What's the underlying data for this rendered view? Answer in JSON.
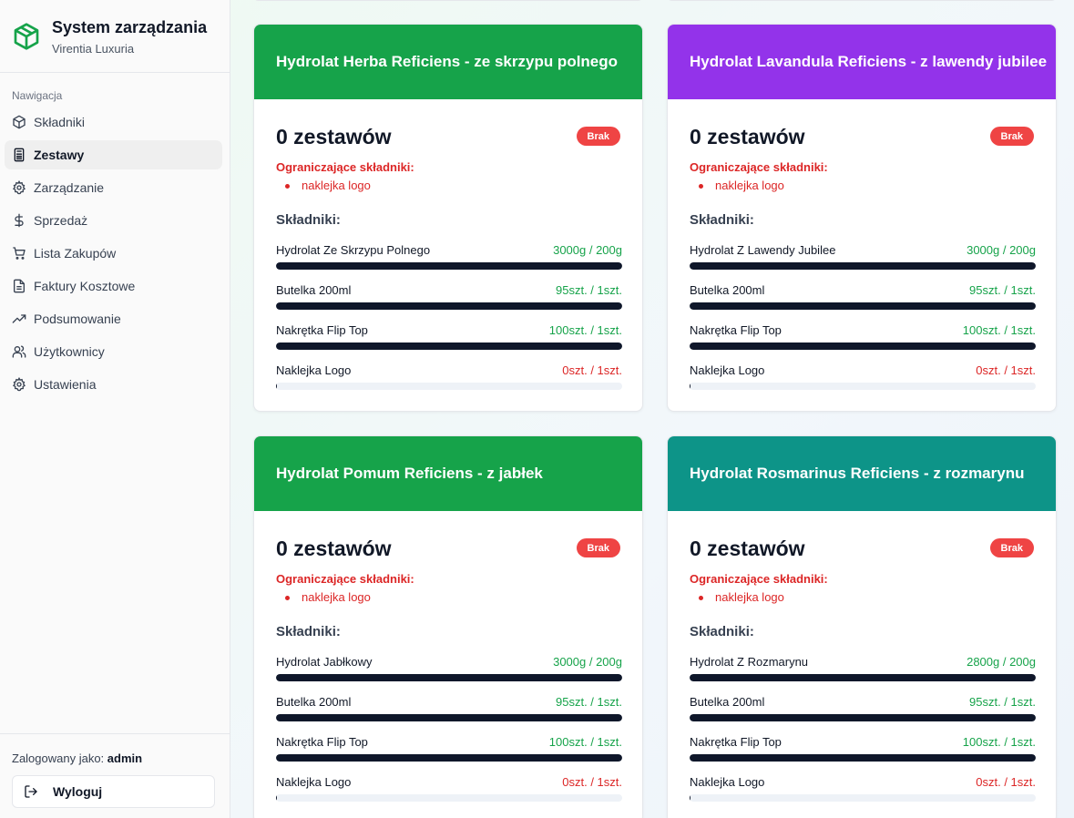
{
  "app": {
    "title": "System zarządzania",
    "subtitle": "Virentia Luxuria",
    "brand_color": "#16a34a"
  },
  "sidebar": {
    "heading": "Nawigacja",
    "items": [
      {
        "label": "Składniki",
        "icon": "box-icon",
        "active": false
      },
      {
        "label": "Zestawy",
        "icon": "calculator-icon",
        "active": true
      },
      {
        "label": "Zarządzanie",
        "icon": "gear-icon",
        "active": false
      },
      {
        "label": "Sprzedaż",
        "icon": "dollar-icon",
        "active": false
      },
      {
        "label": "Lista Zakupów",
        "icon": "cart-icon",
        "active": false
      },
      {
        "label": "Faktury Kosztowe",
        "icon": "file-icon",
        "active": false
      },
      {
        "label": "Podsumowanie",
        "icon": "trending-up-icon",
        "active": false
      },
      {
        "label": "Użytkownicy",
        "icon": "users-icon",
        "active": false
      },
      {
        "label": "Ustawienia",
        "icon": "settings-icon",
        "active": false
      }
    ],
    "logged_prefix": "Zalogowany jako:",
    "logged_user": "admin",
    "logout_label": "Wyloguj"
  },
  "cards": [
    {
      "title": "Hydrolat Herba Reficiens - ze skrzypu polnego",
      "color": "#16a34a",
      "sets": "0 zestawów",
      "badge": "Brak",
      "limit_title": "Ograniczające składniki:",
      "limits": [
        "naklejka logo"
      ],
      "ing_title": "Składniki:",
      "ingredients": [
        {
          "name": "Hydrolat Ze Skrzypu Polnego",
          "qty": "3000g / 200g",
          "ok": true,
          "fill": 1.0
        },
        {
          "name": "Butelka 200ml",
          "qty": "95szt. / 1szt.",
          "ok": true,
          "fill": 1.0
        },
        {
          "name": "Nakrętka Flip Top",
          "qty": "100szt. / 1szt.",
          "ok": true,
          "fill": 1.0
        },
        {
          "name": "Naklejka Logo",
          "qty": "0szt. / 1szt.",
          "ok": false,
          "fill": 0.0
        }
      ]
    },
    {
      "title": "Hydrolat Lavandula Reficiens - z lawendy jubilee",
      "color": "#9333ea",
      "sets": "0 zestawów",
      "badge": "Brak",
      "limit_title": "Ograniczające składniki:",
      "limits": [
        "naklejka logo"
      ],
      "ing_title": "Składniki:",
      "ingredients": [
        {
          "name": "Hydrolat Z Lawendy Jubilee",
          "qty": "3000g / 200g",
          "ok": true,
          "fill": 1.0
        },
        {
          "name": "Butelka 200ml",
          "qty": "95szt. / 1szt.",
          "ok": true,
          "fill": 1.0
        },
        {
          "name": "Nakrętka Flip Top",
          "qty": "100szt. / 1szt.",
          "ok": true,
          "fill": 1.0
        },
        {
          "name": "Naklejka Logo",
          "qty": "0szt. / 1szt.",
          "ok": false,
          "fill": 0.0
        }
      ]
    },
    {
      "title": "Hydrolat Pomum Reficiens - z jabłek",
      "color": "#16a34a",
      "sets": "0 zestawów",
      "badge": "Brak",
      "limit_title": "Ograniczające składniki:",
      "limits": [
        "naklejka logo"
      ],
      "ing_title": "Składniki:",
      "ingredients": [
        {
          "name": "Hydrolat Jabłkowy",
          "qty": "3000g / 200g",
          "ok": true,
          "fill": 1.0
        },
        {
          "name": "Butelka 200ml",
          "qty": "95szt. / 1szt.",
          "ok": true,
          "fill": 1.0
        },
        {
          "name": "Nakrętka Flip Top",
          "qty": "100szt. / 1szt.",
          "ok": true,
          "fill": 1.0
        },
        {
          "name": "Naklejka Logo",
          "qty": "0szt. / 1szt.",
          "ok": false,
          "fill": 0.0
        }
      ]
    },
    {
      "title": "Hydrolat Rosmarinus Reficiens - z rozmarynu",
      "color": "#0d9488",
      "sets": "0 zestawów",
      "badge": "Brak",
      "limit_title": "Ograniczające składniki:",
      "limits": [
        "naklejka logo"
      ],
      "ing_title": "Składniki:",
      "ingredients": [
        {
          "name": "Hydrolat Z Rozmarynu",
          "qty": "2800g / 200g",
          "ok": true,
          "fill": 1.0
        },
        {
          "name": "Butelka 200ml",
          "qty": "95szt. / 1szt.",
          "ok": true,
          "fill": 1.0
        },
        {
          "name": "Nakrętka Flip Top",
          "qty": "100szt. / 1szt.",
          "ok": true,
          "fill": 1.0
        },
        {
          "name": "Naklejka Logo",
          "qty": "0szt. / 1szt.",
          "ok": false,
          "fill": 0.0
        }
      ]
    }
  ]
}
